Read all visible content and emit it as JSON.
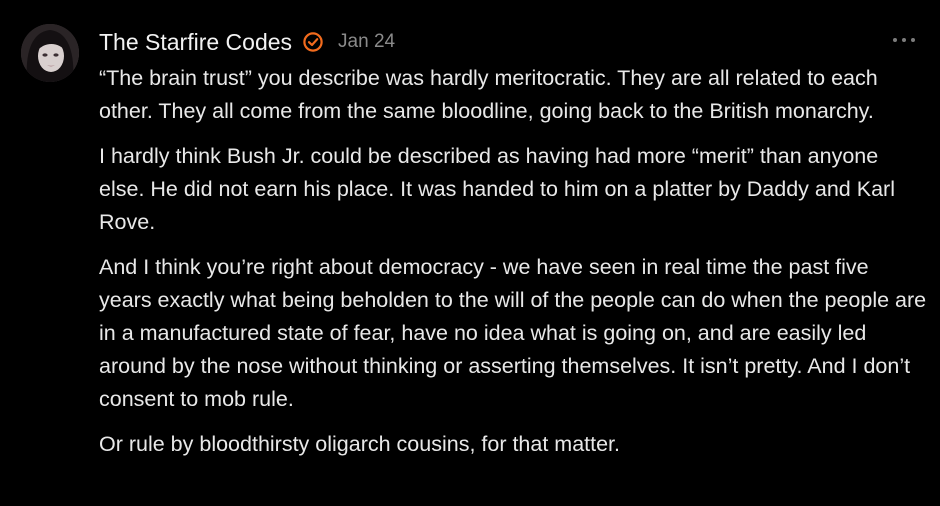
{
  "comment": {
    "author": "The Starfire Codes",
    "badge_icon": "verified-check-icon",
    "badge_color": "#f26b1d",
    "date": "Jan 24",
    "more_icon": "more-dots-icon",
    "paragraphs": [
      "“The brain trust” you describe was hardly meritocratic. They are all related to each other. They all come from the same bloodline, going back to the British monarchy.",
      "I hardly think Bush Jr. could be described as having had more “merit” than anyone else. He did not earn his place. It was handed to him on a platter by Daddy and Karl Rove.",
      "And I think you’re right about democracy - we have seen in real time the past five years exactly what being beholden to the will of the people can do when the people are in a manufactured state of fear, have no idea what is going on, and are easily led around by the nose without thinking or asserting themselves. It isn’t pretty. And I don’t consent to mob rule.",
      "Or rule by bloodthirsty oligarch cousins, for that matter."
    ]
  }
}
